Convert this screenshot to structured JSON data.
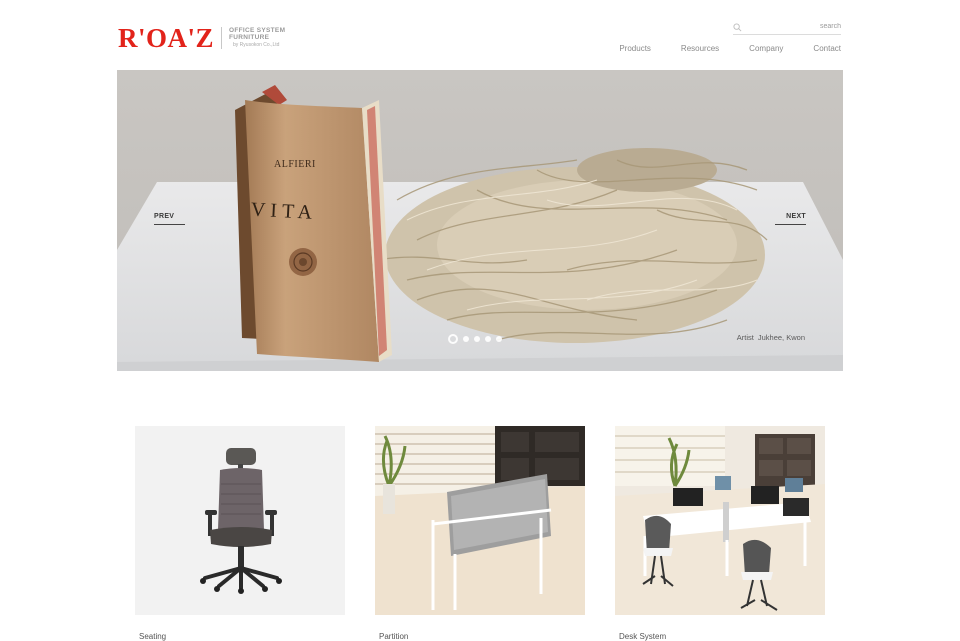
{
  "brand": {
    "logo_text": "R'OA'Z",
    "tagline_1": "OFFICE SYSTEM",
    "tagline_2": "FURNITURE",
    "tagline_3": "by Ryusokon Co.,Ltd",
    "accent_color": "#e2231a"
  },
  "search": {
    "placeholder": "search",
    "icon": "search-icon"
  },
  "nav": {
    "items": [
      "Products",
      "Resources",
      "Company",
      "Contact"
    ]
  },
  "hero": {
    "prev_label": "PREV",
    "next_label": "NEXT",
    "slide_count": 5,
    "active_slide": 1,
    "artist_prefix": "Artist",
    "artist_name": "Jukhee, Kwon",
    "book_title_small": "ALFIERI",
    "book_title_large": "VITA"
  },
  "products": [
    {
      "label": "Seating"
    },
    {
      "label": "Partition"
    },
    {
      "label": "Desk System"
    }
  ]
}
